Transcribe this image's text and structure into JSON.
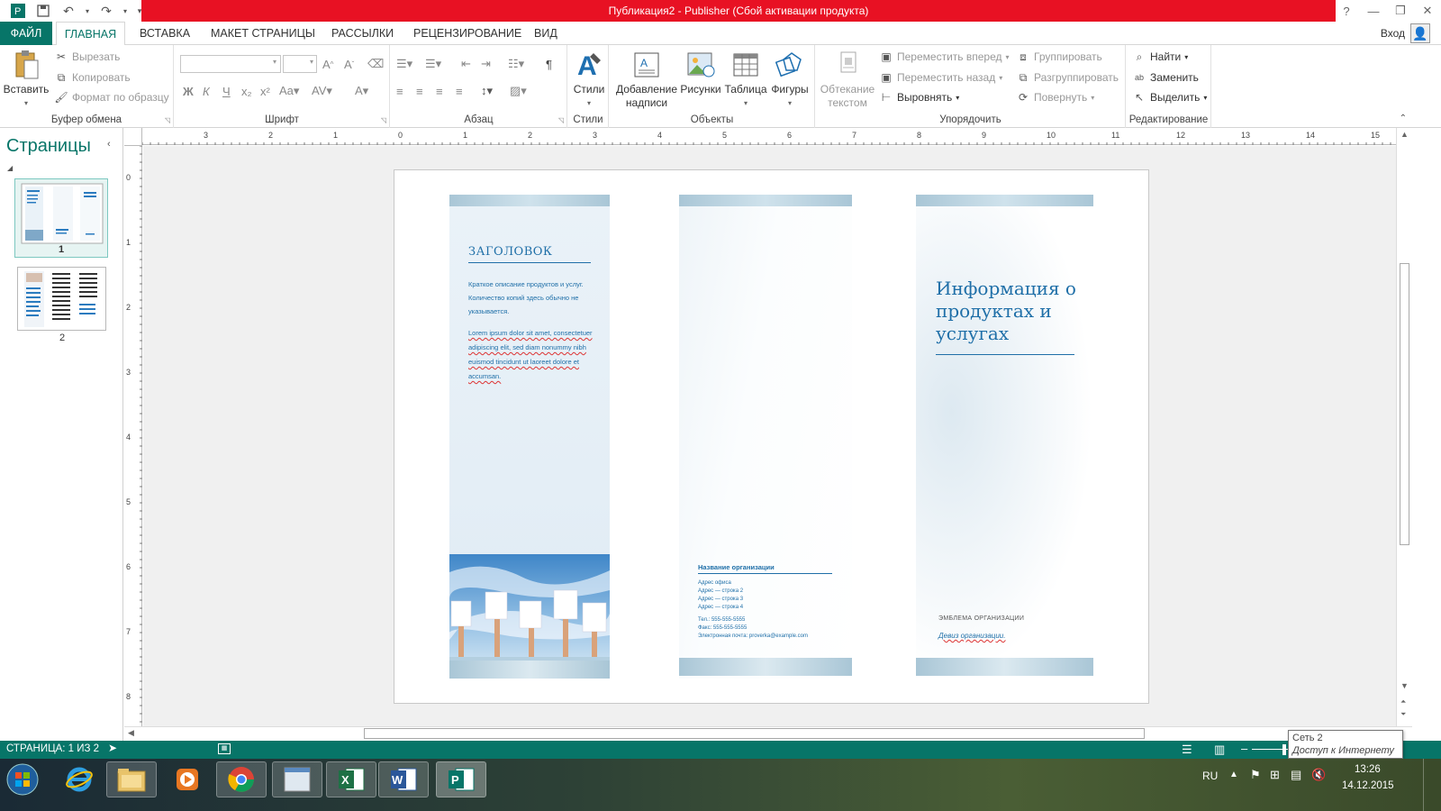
{
  "app": {
    "window_title": "Публикация2 - Publisher (Сбой активации продукта)",
    "help": "?",
    "login": "Вход"
  },
  "tabs": [
    {
      "label": "ФАЙЛ"
    },
    {
      "label": "ГЛАВНАЯ"
    },
    {
      "label": "ВСТАВКА"
    },
    {
      "label": "МАКЕТ СТРАНИЦЫ"
    },
    {
      "label": "РАССЫЛКИ"
    },
    {
      "label": "РЕЦЕНЗИРОВАНИЕ"
    },
    {
      "label": "ВИД"
    }
  ],
  "ribbon": {
    "clipboard": {
      "label": "Буфер обмена",
      "paste": "Вставить",
      "cut": "Вырезать",
      "copy": "Копировать",
      "format_painter": "Формат по образцу"
    },
    "font": {
      "label": "Шрифт",
      "bold": "Ж",
      "italic": "К",
      "underline": "Ч"
    },
    "paragraph": {
      "label": "Абзац"
    },
    "styles": {
      "label": "Стили",
      "button": "Стили"
    },
    "objects": {
      "label": "Объекты",
      "textbox": "Добавление надписи",
      "pictures": "Рисунки",
      "table": "Таблица",
      "shapes": "Фигуры"
    },
    "arrange": {
      "label": "Упорядочить",
      "wrap": "Обтекание текстом",
      "bring_forward": "Переместить вперед",
      "send_backward": "Переместить назад",
      "align": "Выровнять",
      "group": "Группировать",
      "ungroup": "Разгруппировать",
      "rotate": "Повернуть"
    },
    "editing": {
      "label": "Редактирование",
      "find": "Найти",
      "replace": "Заменить",
      "select": "Выделить"
    }
  },
  "pages_pane": {
    "title": "Страницы",
    "pages": [
      {
        "number": "1"
      },
      {
        "number": "2"
      }
    ]
  },
  "ruler": {
    "h_labels": [
      "3",
      "2",
      "1",
      "0",
      "1",
      "2",
      "3",
      "4",
      "5",
      "6",
      "7",
      "8",
      "9",
      "10",
      "11",
      "12",
      "13",
      "14",
      "15"
    ],
    "v_labels": [
      "0",
      "1",
      "2",
      "3",
      "4",
      "5",
      "6",
      "7",
      "8"
    ]
  },
  "publication": {
    "left": {
      "heading": "ЗАГОЛОВОК",
      "summary": "Краткое описание продуктов и услуг. Количество копий здесь обычно не указывается.",
      "lorem": "Lorem ipsum dolor sit amet, consectetuer adipiscing elit, sed diam nonummy nibh euismod tincidunt ut laoreet dolore et accumsan."
    },
    "middle": {
      "org_name": "Название организации",
      "address": [
        "Адрес офиса",
        "Адрес — строка 2",
        "Адрес — строка 3",
        "Адрес — строка 4"
      ],
      "phone": "Тел.: 555-555-5555",
      "fax": "Факс: 555-555-5555",
      "email": "Электронная почта: proverka@example.com"
    },
    "right": {
      "title": "Информация о продуктах и услугах",
      "logo": "ЭМБЛЕМА ОРГАНИЗАЦИИ",
      "motto": "Девиз организации."
    }
  },
  "status": {
    "page": "СТРАНИЦА: 1 ИЗ 2"
  },
  "tooltip": {
    "line1": "Сеть  2",
    "line2": "Доступ к Интернету"
  },
  "taskbar": {
    "lang": "RU",
    "time": "13:26",
    "date": "14.12.2015"
  },
  "colors": {
    "accent": "#077568",
    "title_bar": "#e81123",
    "brochure_blue": "#1f6fa8"
  }
}
